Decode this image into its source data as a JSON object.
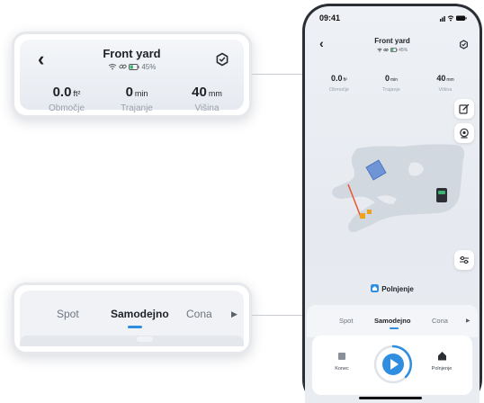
{
  "header": {
    "title": "Front yard",
    "battery_percent": "45%",
    "battery_level": 0.45
  },
  "stats": [
    {
      "value": "0.0",
      "unit": "ft²",
      "label": "Območje"
    },
    {
      "value": "0",
      "unit": "min",
      "label": "Trajanje"
    },
    {
      "value": "40",
      "unit": "mm",
      "label": "Višina"
    }
  ],
  "status_bar": {
    "time": "09:41"
  },
  "tabs": {
    "items": [
      "Spot",
      "Samodejno",
      "Cona"
    ],
    "active": "Samodejno"
  },
  "status_text": "Polnjenje",
  "controls": {
    "stop_label": "Konec",
    "home_label": "Polnjenje"
  },
  "colors": {
    "accent": "#2f8ee0",
    "zone_fill": "#6f95d6",
    "boundary_line": "#e9552f",
    "path_marker": "#f0a21f"
  },
  "icons": {
    "back": "chevron-left-icon",
    "settings": "hexagon-settings-icon",
    "edit": "edit-icon",
    "camera": "camera-icon",
    "adjust": "sliders-icon",
    "stop": "stop-icon",
    "play": "play-icon",
    "home": "home-icon",
    "wifi": "wifi-icon",
    "link": "link-icon",
    "battery": "battery-icon"
  }
}
